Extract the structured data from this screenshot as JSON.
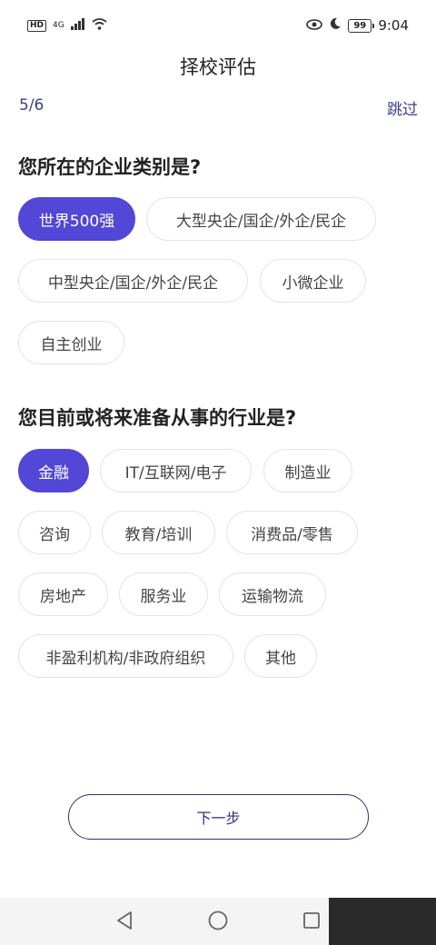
{
  "status_bar": {
    "hd": "HD",
    "net": "4G",
    "battery": "99",
    "time": "9:04"
  },
  "header": {
    "title": "择校评估",
    "progress": "5/6",
    "skip_label": "跳过"
  },
  "section1": {
    "question": "您所在的企业类别是?",
    "options": [
      "世界500强",
      "大型央企/国企/外企/民企",
      "中型央企/国企/外企/民企",
      "小微企业",
      "自主创业"
    ],
    "selected": "世界500强"
  },
  "section2": {
    "question": "您目前或将来准备从事的行业是?",
    "options": [
      "金融",
      "IT/互联网/电子",
      "制造业",
      "咨询",
      "教育/培训",
      "消费品/零售",
      "房地产",
      "服务业",
      "运输物流",
      "非盈利机构/非政府组织",
      "其他"
    ],
    "selected": "金融"
  },
  "footer": {
    "next_label": "下一步"
  },
  "colors": {
    "accent": "#5247d6",
    "link": "#3b3f8c",
    "button_border": "#2d3270"
  }
}
